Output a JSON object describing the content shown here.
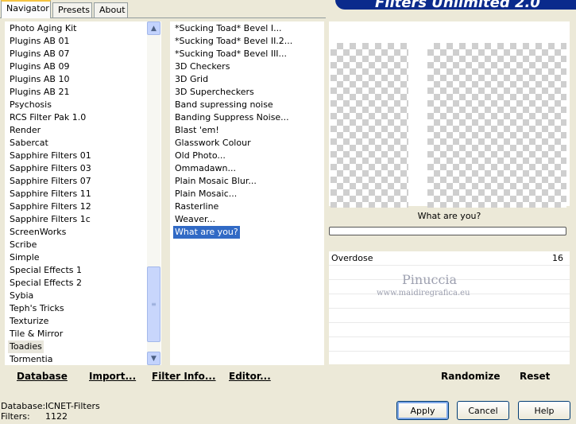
{
  "tabs": [
    "Navigator",
    "Presets",
    "About"
  ],
  "banner_title": "Filters Unlimited 2.0",
  "categories": [
    "Photo Aging Kit",
    "Plugins AB 01",
    "Plugins AB 07",
    "Plugins AB 09",
    "Plugins AB 10",
    "Plugins AB 21",
    "Psychosis",
    "RCS Filter Pak 1.0",
    "Render",
    "Sabercat",
    "Sapphire Filters 01",
    "Sapphire Filters 03",
    "Sapphire Filters 07",
    "Sapphire Filters 11",
    "Sapphire Filters 12",
    "Sapphire Filters 1c",
    "ScreenWorks",
    "Scribe",
    "Simple",
    "Special Effects 1",
    "Special Effects 2",
    "Sybia",
    "Teph's Tricks",
    "Texturize",
    "Tile & Mirror",
    "Toadies",
    "Tormentia"
  ],
  "selected_category": "Toadies",
  "filters": [
    "*Sucking Toad*  Bevel I...",
    "*Sucking Toad*  Bevel II.2...",
    "*Sucking Toad*  Bevel III...",
    "3D Checkers",
    "3D Grid",
    "3D Supercheckers",
    "Band supressing noise",
    "Banding Suppress Noise...",
    "Blast 'em!",
    "Glasswork Colour",
    "Old Photo...",
    "Ommadawn...",
    "Plain Mosaic Blur...",
    "Plain Mosaic...",
    "Rasterline",
    "Weaver...",
    "What are you?"
  ],
  "selected_filter": "What are you?",
  "filter_name": "What are you?",
  "parameter": {
    "label": "Overdose",
    "value": "16"
  },
  "watermark": {
    "line1": "Pinuccia",
    "line2": "www.maidiregrafica.eu"
  },
  "toolbar": {
    "database": "Database",
    "import": "Import...",
    "filter_info": "Filter Info...",
    "editor": "Editor...",
    "randomize": "Randomize",
    "reset": "Reset"
  },
  "status": {
    "database_label": "Database:",
    "database_value": "ICNET-Filters",
    "filters_label": "Filters:",
    "filters_value": "1122"
  },
  "buttons": {
    "apply": "Apply",
    "cancel": "Cancel",
    "help": "Help"
  }
}
